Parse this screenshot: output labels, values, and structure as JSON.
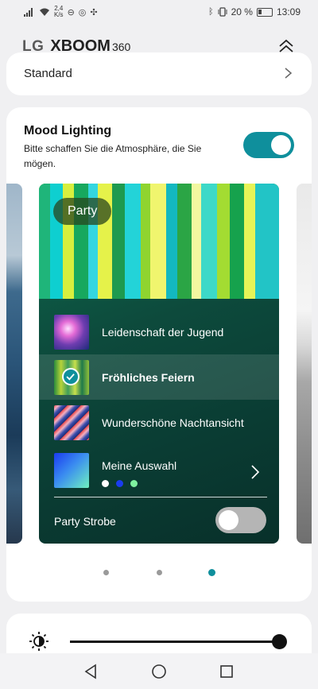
{
  "status_bar": {
    "speed_value": "2,4",
    "speed_unit": "K/s",
    "battery": "20 %",
    "time": "13:09"
  },
  "header": {
    "brand": "LG",
    "product": "XBOOM",
    "model": "360",
    "collapse_icon": "double-chevron-up-icon"
  },
  "top_card": {
    "label": "Standard"
  },
  "mood_lighting": {
    "title": "Mood Lighting",
    "description": "Bitte schaffen Sie die Atmosphäre, die Sie mögen.",
    "enabled": true,
    "accent_color": "#0f8f9c",
    "card": {
      "title": "Party",
      "scenes": [
        {
          "label": "Leidenschaft der Jugend",
          "selected": false
        },
        {
          "label": "Fröhliches Feiern",
          "selected": true
        },
        {
          "label": "Wunderschöne Nachtansicht",
          "selected": false
        },
        {
          "label": "Meine Auswahl",
          "selected": false
        }
      ],
      "custom_colors": [
        "#ffffff",
        "#1a3cf0",
        "#7ef2a0"
      ],
      "strobe_label": "Party Strobe",
      "strobe_enabled": false
    },
    "pager": {
      "count": 3,
      "active_index": 2
    }
  },
  "brightness": {
    "icon": "brightness-icon",
    "level": 1.0
  },
  "nav": {
    "back_icon": "back-triangle-icon",
    "home_icon": "home-circle-icon",
    "recents_icon": "recents-square-icon"
  }
}
